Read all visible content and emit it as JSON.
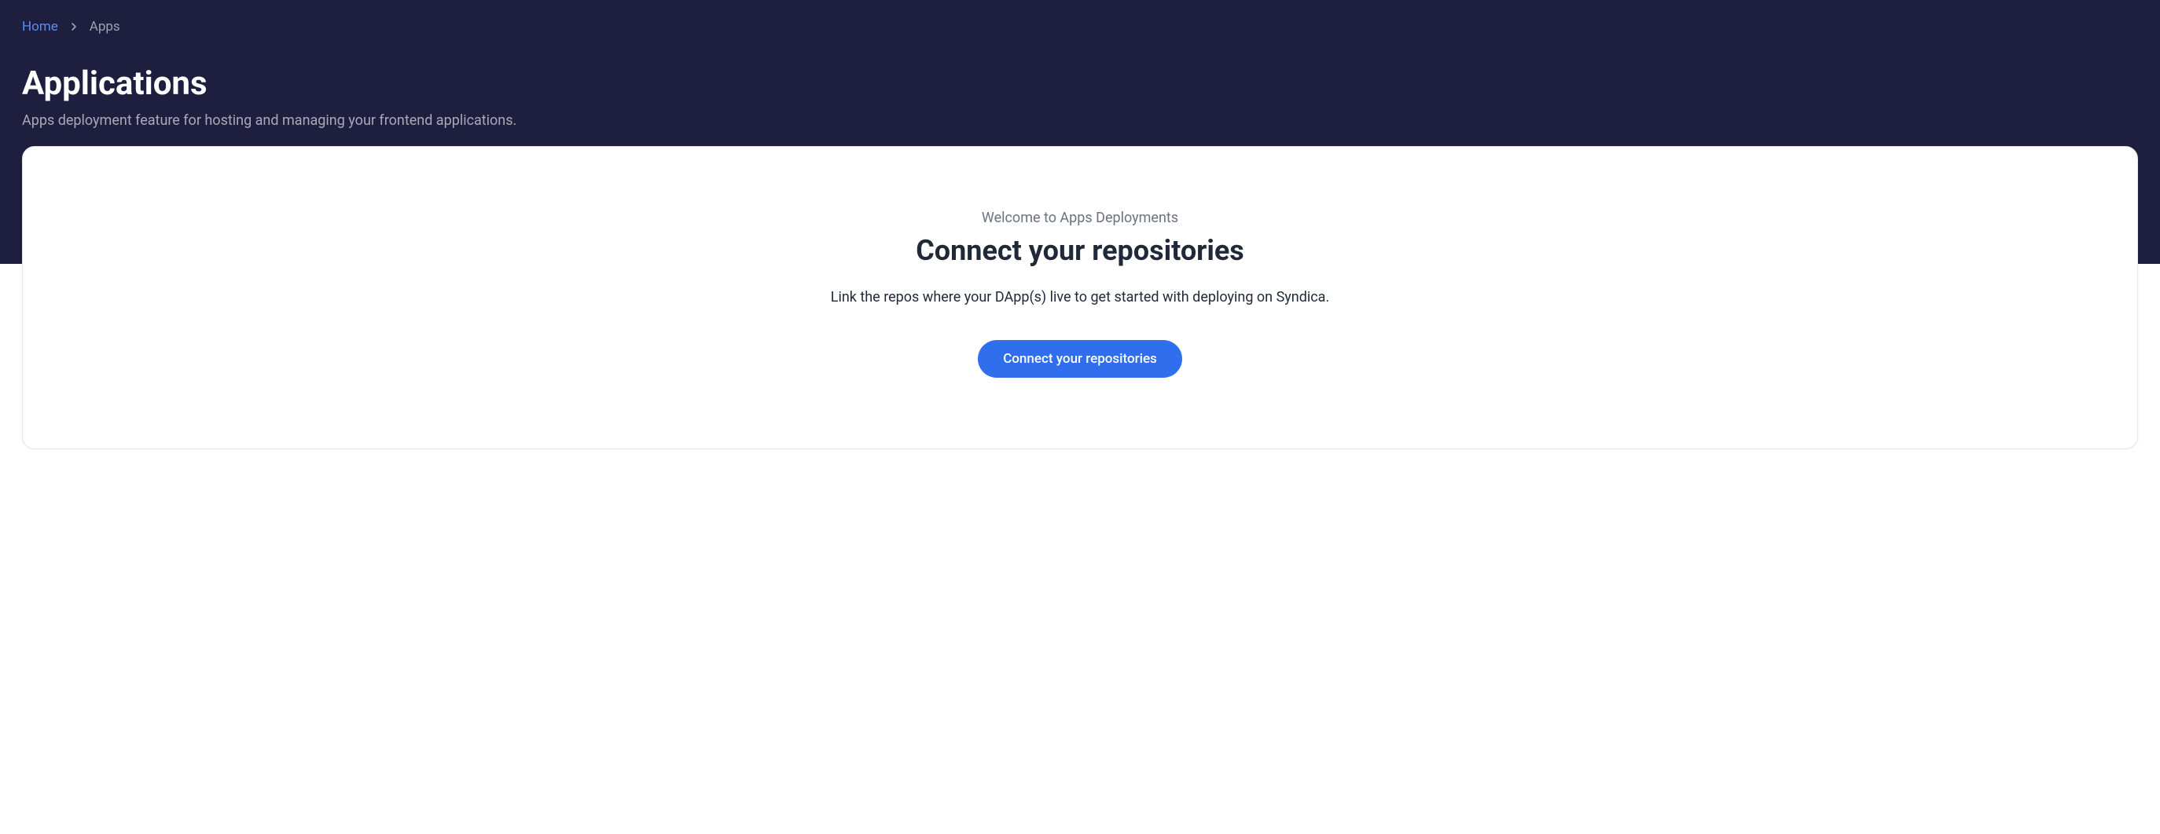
{
  "breadcrumb": {
    "home": "Home",
    "current": "Apps"
  },
  "header": {
    "title": "Applications",
    "subtitle": "Apps deployment feature for hosting and managing your frontend applications."
  },
  "card": {
    "eyebrow": "Welcome to Apps Deployments",
    "heading": "Connect your repositories",
    "description": "Link the repos where your DApp(s) live to get started with deploying on Syndica.",
    "buttonLabel": "Connect your repositories"
  }
}
